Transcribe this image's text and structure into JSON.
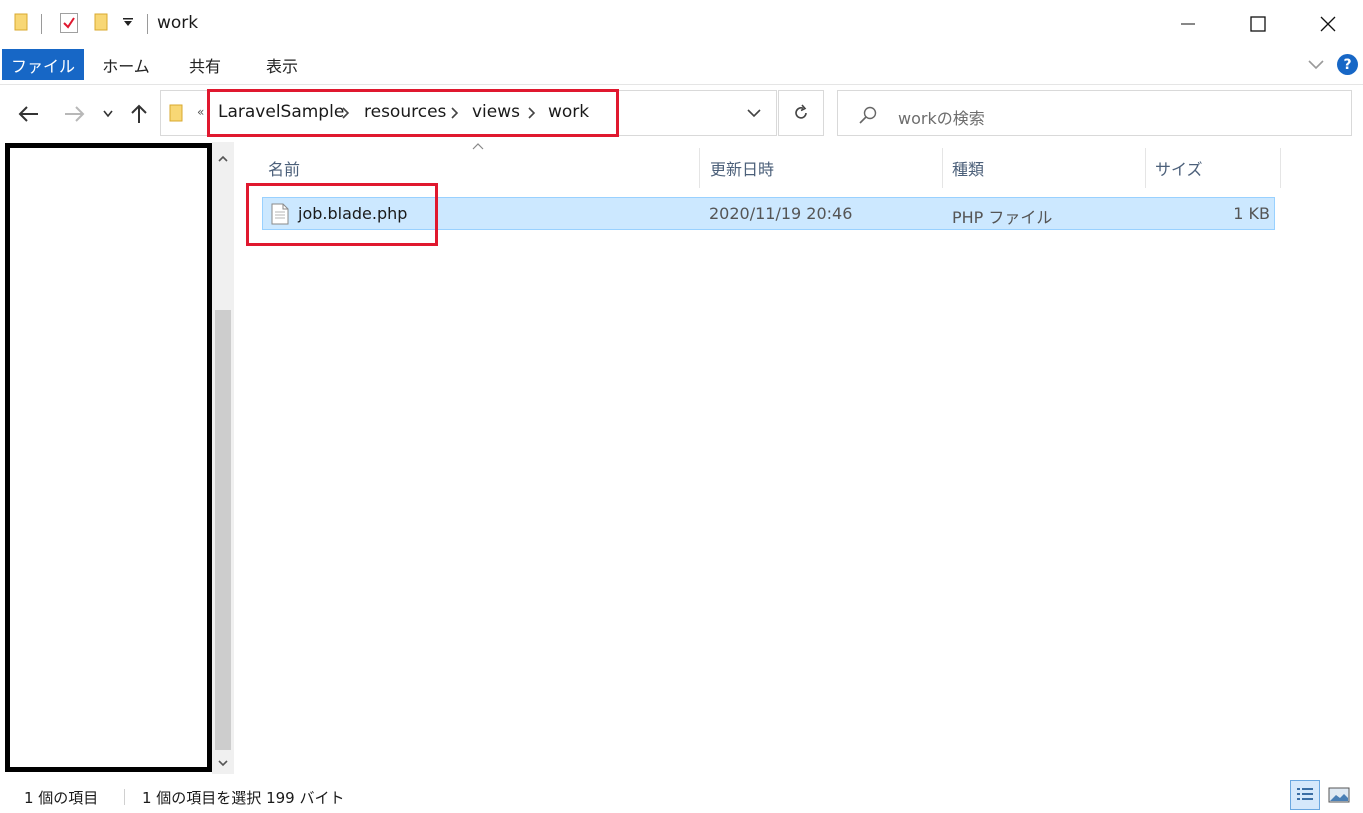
{
  "window": {
    "title": "work"
  },
  "ribbon": {
    "tabs": [
      {
        "label": "ファイル",
        "active": true
      },
      {
        "label": "ホーム"
      },
      {
        "label": "共有"
      },
      {
        "label": "表示"
      }
    ],
    "help_label": "?"
  },
  "address": {
    "overflow": "«",
    "breadcrumbs": [
      "LaravelSample",
      "resources",
      "views",
      "work"
    ]
  },
  "search": {
    "placeholder": "workの検索"
  },
  "columns": {
    "name": "名前",
    "modified": "更新日時",
    "type": "種類",
    "size": "サイズ"
  },
  "files": [
    {
      "name": "job.blade.php",
      "modified": "2020/11/19 20:46",
      "type": "PHP ファイル",
      "size": "1 KB",
      "selected": true
    }
  ],
  "status": {
    "item_count": "1 個の項目",
    "selection": "1 個の項目を選択  199 バイト"
  },
  "colors": {
    "accent": "#1767c6",
    "selection": "#cce8ff",
    "highlight": "#e0182f",
    "folder": "#f8d775"
  }
}
